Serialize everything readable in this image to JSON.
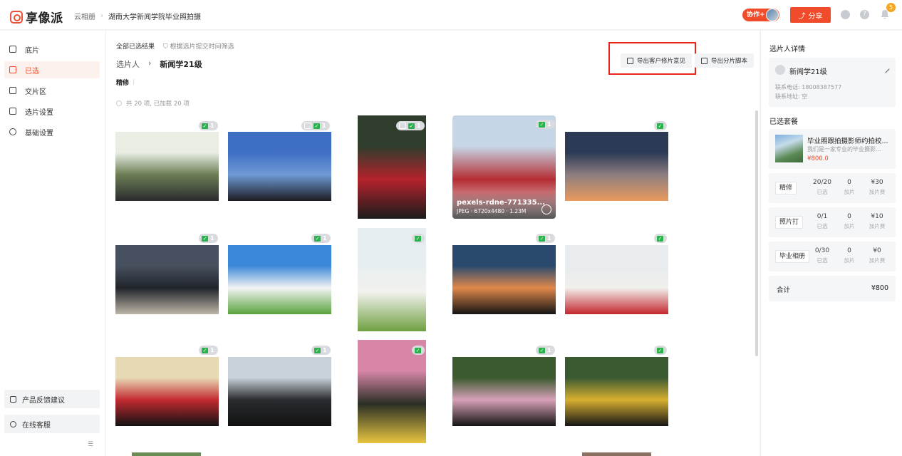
{
  "app": {
    "logo_text": "享像派"
  },
  "breadcrumb": {
    "root": "云相册",
    "current": "湖南大学新闻学院毕业照拍摄"
  },
  "header": {
    "collab_label": "协作+",
    "share_label": "分享",
    "notification_count": "5"
  },
  "sidebar": {
    "items": [
      {
        "label": "底片",
        "icon": "film-icon",
        "active": false
      },
      {
        "label": "已选",
        "icon": "selected-icon",
        "active": true
      },
      {
        "label": "交片区",
        "icon": "delivery-icon",
        "active": false
      },
      {
        "label": "选片设置",
        "icon": "selection-settings-icon",
        "active": false
      },
      {
        "label": "基础设置",
        "icon": "gear-icon",
        "active": false
      }
    ],
    "feedback_label": "产品反馈建议",
    "support_label": "在线客服"
  },
  "main": {
    "tab_label": "全部已选结果",
    "filter_label": "根据选片提交时间筛选",
    "selector_label": "选片人",
    "selector_name": "新闻学21级",
    "subtab_label": "精修",
    "count_text": "共 20 项,  已加载 20 项",
    "export_feedback_label": "导出客户修片意见",
    "export_script_label": "导出分片脚本"
  },
  "photos": [
    {
      "id": "p1",
      "badge": "1",
      "comment": false,
      "colors": [
        "#e9eee5",
        "#6c7e55",
        "#2a2a2e"
      ]
    },
    {
      "id": "p2",
      "badge": "1",
      "comment": true,
      "colors": [
        "#3f6fc4",
        "#6f9ad6",
        "#1c1c22"
      ]
    },
    {
      "id": "p3",
      "badge": "1",
      "comment": true,
      "colors": [
        "#2f3d2c",
        "#b4232c",
        "#1b1b1b"
      ]
    },
    {
      "id": "p4",
      "badge": "1",
      "comment": false,
      "hover": true,
      "hover_name": "pexels-rdne-771335...",
      "hover_meta": "JPEG · 6720x4480 · 1.23M",
      "colors": [
        "#c6d6e6",
        "#b52d33",
        "#efefef"
      ]
    },
    {
      "id": "p5",
      "badge": "",
      "comment": false,
      "colors": [
        "#2c3a55",
        "#8c7d80",
        "#e99a5d"
      ]
    },
    {
      "id": "p6",
      "badge": "1",
      "comment": false,
      "colors": [
        "#47505e",
        "#20242a",
        "#bdb5a8"
      ]
    },
    {
      "id": "p7",
      "badge": "1",
      "comment": false,
      "colors": [
        "#3c88d8",
        "#f3f3f3",
        "#58a33e"
      ]
    },
    {
      "id": "p8",
      "badge": "",
      "comment": false,
      "colors": [
        "#e5edf1",
        "#f2f2ee",
        "#6fa040"
      ]
    },
    {
      "id": "p9",
      "badge": "1",
      "comment": false,
      "colors": [
        "#294a6e",
        "#e0884a",
        "#141414"
      ]
    },
    {
      "id": "p10",
      "badge": "",
      "comment": false,
      "colors": [
        "#e8ecef",
        "#f0f0ec",
        "#c4262d"
      ]
    },
    {
      "id": "p11",
      "badge": "1",
      "comment": false,
      "colors": [
        "#e8d9b5",
        "#c32b31",
        "#121212"
      ]
    },
    {
      "id": "p12",
      "badge": "1",
      "comment": false,
      "colors": [
        "#c8d2d8",
        "#2a2c30",
        "#111111"
      ]
    },
    {
      "id": "p13",
      "badge": "",
      "comment": false,
      "colors": [
        "#d786a8",
        "#2a2f24",
        "#e8c540"
      ]
    },
    {
      "id": "p14",
      "badge": "1",
      "comment": false,
      "colors": [
        "#3b5a2e",
        "#d8a0b8",
        "#141414"
      ]
    },
    {
      "id": "p15",
      "badge": "",
      "comment": false,
      "colors": [
        "#3a5a32",
        "#d8b030",
        "#151515"
      ]
    }
  ],
  "right_panel": {
    "detail_title": "选片人详情",
    "person_name": "新闻学21级",
    "phone_text": "联系电话: 18008387577",
    "address_text": "联系地址: 空",
    "package_title": "已选套餐",
    "package_name": "毕业照跟拍摄影师约拍校...",
    "package_desc": "我们是一家专业的毕业摄影...",
    "package_price": "¥800.0",
    "rows": [
      {
        "tag": "精修",
        "selected": "20/20",
        "addon": "0",
        "fee": "¥30",
        "selected_label": "已选",
        "addon_label": "加片",
        "fee_label": "加片费"
      },
      {
        "tag": "照片打",
        "selected": "0/1",
        "addon": "0",
        "fee": "¥10",
        "selected_label": "已选",
        "addon_label": "加片",
        "fee_label": "加片费"
      },
      {
        "tag": "毕业相册",
        "selected": "0/30",
        "addon": "0",
        "fee": "¥0",
        "selected_label": "已选",
        "addon_label": "加片",
        "fee_label": "加片费"
      }
    ],
    "total_label": "合计",
    "total_value": "¥800"
  },
  "colors": {
    "accent": "#f04b2a",
    "check_green": "#2bb24c",
    "highlight_red": "#e8251b"
  }
}
